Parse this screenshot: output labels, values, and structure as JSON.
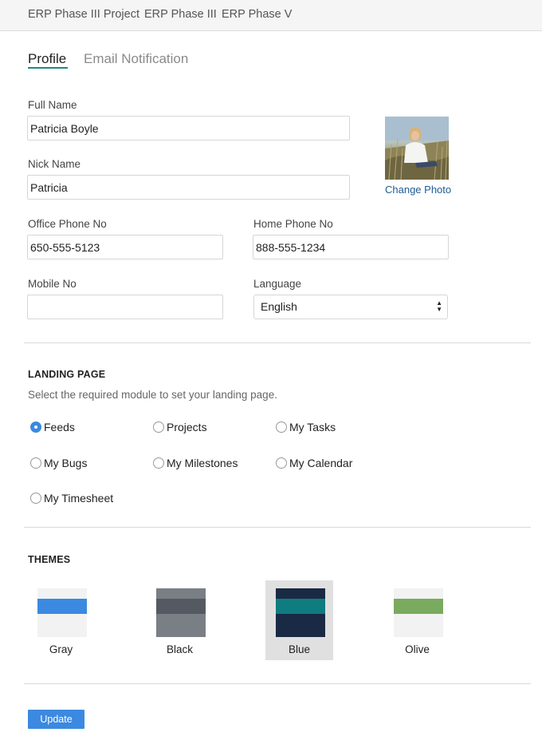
{
  "breadcrumbs": [
    "ERP Phase III Project",
    "ERP Phase III",
    "ERP Phase V"
  ],
  "tabs": [
    {
      "label": "Profile",
      "active": true
    },
    {
      "label": "Email Notification",
      "active": false
    }
  ],
  "form": {
    "full_name": {
      "label": "Full Name",
      "value": "Patricia Boyle"
    },
    "nick_name": {
      "label": "Nick Name",
      "value": "Patricia"
    },
    "office_phone": {
      "label": "Office Phone No",
      "value": "650-555-5123"
    },
    "home_phone": {
      "label": "Home Phone No",
      "value": "888-555-1234"
    },
    "mobile": {
      "label": "Mobile No",
      "value": ""
    },
    "language": {
      "label": "Language",
      "value": "English"
    }
  },
  "photo": {
    "change_label": "Change Photo"
  },
  "landing_page": {
    "title": "LANDING PAGE",
    "helper": "Select the required module to set your landing page.",
    "options": [
      {
        "label": "Feeds",
        "checked": true
      },
      {
        "label": "Projects",
        "checked": false
      },
      {
        "label": "My Tasks",
        "checked": false
      },
      {
        "label": "My Bugs",
        "checked": false
      },
      {
        "label": "My Milestones",
        "checked": false
      },
      {
        "label": "My Calendar",
        "checked": false
      },
      {
        "label": "My Timesheet",
        "checked": false
      }
    ]
  },
  "themes": {
    "title": "THEMES",
    "items": [
      {
        "label": "Gray",
        "bg": "#f2f2f2",
        "band": "#3b89e0",
        "selected": false
      },
      {
        "label": "Black",
        "bg": "#7a7f86",
        "band": "#555a62",
        "selected": false
      },
      {
        "label": "Blue",
        "bg": "#1b2a44",
        "band": "#0f7c80",
        "selected": true
      },
      {
        "label": "Olive",
        "bg": "#f2f2f2",
        "band": "#7aaa5e",
        "selected": false
      }
    ]
  },
  "actions": {
    "update_label": "Update"
  },
  "colors": {
    "accent": "#3b89e0",
    "tab_underline": "#1e8a84",
    "link": "#1d5b95"
  }
}
